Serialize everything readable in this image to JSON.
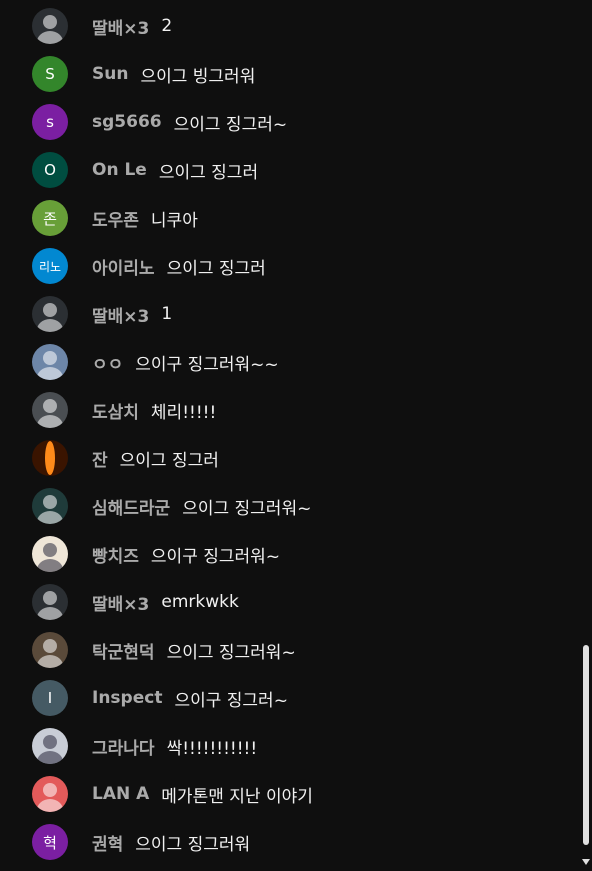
{
  "messages": [
    {
      "author": "딸배×3",
      "text": "2",
      "avatar": {
        "kind": "photo",
        "icon": "baseball-player-photo",
        "color": "#2b2f33"
      }
    },
    {
      "author": "Sun",
      "text": "으이그 빙그러워",
      "avatar": {
        "kind": "letter",
        "letter": "S",
        "color": "#33862b"
      }
    },
    {
      "author": "sg5666",
      "text": "으이그 징그러~",
      "avatar": {
        "kind": "letter",
        "letter": "s",
        "color": "#7b1fa2"
      }
    },
    {
      "author": "On Le",
      "text": "으이그 징그러",
      "avatar": {
        "kind": "letter",
        "letter": "O",
        "color": "#004d40"
      }
    },
    {
      "author": "도우존",
      "text": "니쿠아",
      "avatar": {
        "kind": "letter",
        "letter": "존",
        "color": "#689f38"
      }
    },
    {
      "author": "아이리노",
      "text": "으이그 징그러",
      "avatar": {
        "kind": "letter",
        "letter": "리노",
        "color": "#0288d1"
      }
    },
    {
      "author": "딸배×3",
      "text": "1",
      "avatar": {
        "kind": "photo",
        "icon": "baseball-player-photo",
        "color": "#2b2f33"
      }
    },
    {
      "author": "ㅇㅇ",
      "text": "으이구 징그러워~~",
      "avatar": {
        "kind": "photo",
        "icon": "city-tower-photo",
        "color": "#6d86a8"
      }
    },
    {
      "author": "도삼치",
      "text": "체리!!!!!",
      "avatar": {
        "kind": "photo",
        "icon": "man-face-photo",
        "color": "#4a4e52"
      }
    },
    {
      "author": "잔",
      "text": "으이그 징그러",
      "avatar": {
        "kind": "photo",
        "icon": "orange-glow-photo",
        "color": "#3a1400"
      }
    },
    {
      "author": "심해드라군",
      "text": "으이그 징그러워~",
      "avatar": {
        "kind": "photo",
        "icon": "dragon-photo",
        "color": "#1f3b3a"
      }
    },
    {
      "author": "빵치즈",
      "text": "으이구 징그러워~",
      "avatar": {
        "kind": "photo",
        "icon": "cartoon-photo",
        "color": "#efe6d8"
      }
    },
    {
      "author": "딸배×3",
      "text": "emrkwkk",
      "avatar": {
        "kind": "photo",
        "icon": "baseball-player-photo",
        "color": "#2b2f33"
      }
    },
    {
      "author": "탁군현덕",
      "text": " 으이그 징그러워~",
      "avatar": {
        "kind": "photo",
        "icon": "smiling-man-photo",
        "color": "#5a4a3a"
      }
    },
    {
      "author": "Inspect",
      "text": "으이구 징그러~",
      "avatar": {
        "kind": "letter",
        "letter": "I",
        "color": "#455a64"
      }
    },
    {
      "author": "그라나다",
      "text": "싹!!!!!!!!!!!",
      "avatar": {
        "kind": "photo",
        "icon": "robot-photo",
        "color": "#c9cdd6"
      }
    },
    {
      "author": "LAN A",
      "text": "메가톤맨 지난 이야기",
      "avatar": {
        "kind": "photo",
        "icon": "cat-cartoon-photo",
        "color": "#e35a5a"
      }
    },
    {
      "author": "권혁",
      "text": "으이그 징그러워",
      "avatar": {
        "kind": "letter",
        "letter": "혁",
        "color": "#7b1fa2"
      }
    }
  ]
}
